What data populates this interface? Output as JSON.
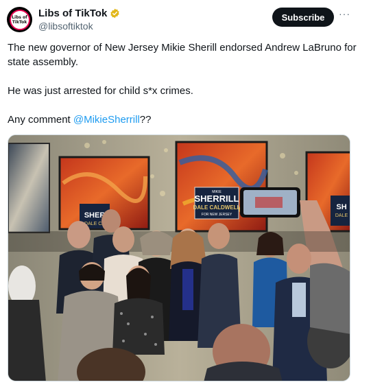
{
  "author": {
    "display_name": "Libs of TikTok",
    "handle": "@libsoftiktok",
    "avatar_text_top": "Libs of",
    "avatar_text_bottom": "TikTok",
    "verified_color": "#e2b719"
  },
  "actions": {
    "subscribe_label": "Subscribe",
    "more_label": "···"
  },
  "tweet": {
    "line1": "The new governor of New Jersey Mikie Sherill endorsed Andrew LaBruno for state assembly.",
    "line2": "He was just arrested for child s*x crimes.",
    "line3_prefix": "Any comment ",
    "line3_mention": "@MikieSherrill",
    "line3_suffix": "??"
  },
  "photo": {
    "sign_small": "MIKIE",
    "sign_name": "SHERRILL",
    "sign_sub": "DALE CALDWELL",
    "sign_footer": "FOR NEW JERSEY",
    "sign_left_name": "SHER",
    "sign_left_sub": "DALE CA",
    "sign_right_name": "SH",
    "sign_right_sub": "DALE",
    "accent_color": "#1d9bf0"
  }
}
